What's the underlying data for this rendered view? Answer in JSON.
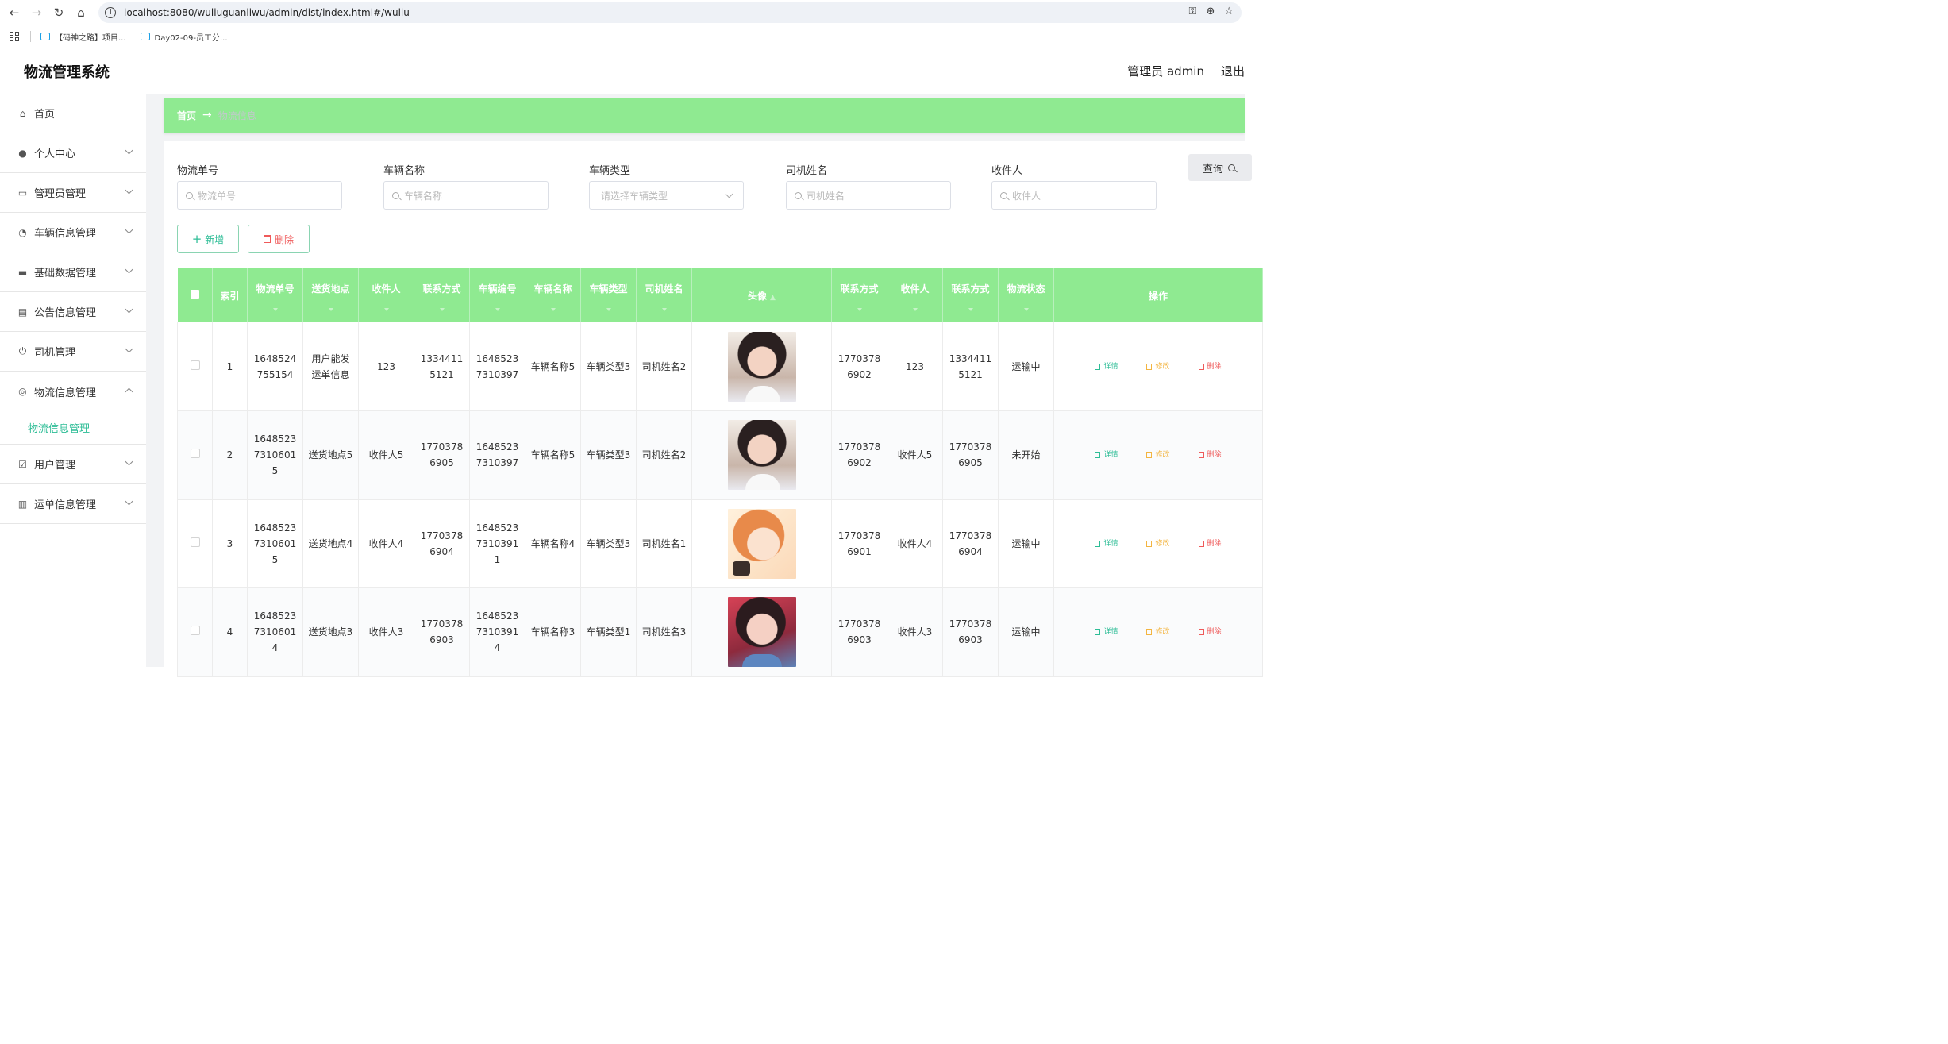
{
  "browser": {
    "url": "localhost:8080/wuliuguanliwu/admin/dist/index.html#/wuliu",
    "bookmarks": [
      "【码神之路】项目...",
      "Day02-09-员工分..."
    ]
  },
  "header": {
    "title": "物流管理系统",
    "user": "管理员 admin",
    "logout": "退出"
  },
  "sidebar": {
    "items": [
      {
        "label": "首页",
        "icon": "home-icon"
      },
      {
        "label": "个人中心",
        "icon": "user-icon"
      },
      {
        "label": "管理员管理",
        "icon": "chat-icon"
      },
      {
        "label": "车辆信息管理",
        "icon": "gauge-icon"
      },
      {
        "label": "基础数据管理",
        "icon": "message-icon"
      },
      {
        "label": "公告信息管理",
        "icon": "clipboard-icon"
      },
      {
        "label": "司机管理",
        "icon": "power-icon"
      },
      {
        "label": "物流信息管理",
        "icon": "compass-icon"
      },
      {
        "label": "用户管理",
        "icon": "checklist-icon"
      },
      {
        "label": "运单信息管理",
        "icon": "bar-chart-icon"
      }
    ],
    "sub_item": "物流信息管理"
  },
  "breadcrumb": {
    "home": "首页",
    "arrow": "→",
    "current": "物流信息"
  },
  "filters": {
    "order_label": "物流单号",
    "order_placeholder": "物流单号",
    "vehicle_name_label": "车辆名称",
    "vehicle_name_placeholder": "车辆名称",
    "vehicle_type_label": "车辆类型",
    "vehicle_type_placeholder": "请选择车辆类型",
    "driver_label": "司机姓名",
    "driver_placeholder": "司机姓名",
    "receiver_label": "收件人",
    "receiver_placeholder": "收件人",
    "query": "查询"
  },
  "actions": {
    "add": "新增",
    "delete": "删除"
  },
  "table": {
    "headers": [
      "索引",
      "物流单号",
      "送货地点",
      "收件人",
      "联系方式",
      "车辆编号",
      "车辆名称",
      "车辆类型",
      "司机姓名",
      "头像",
      "联系方式",
      "收件人",
      "联系方式",
      "物流状态",
      "操作"
    ],
    "rows": [
      {
        "index": "1",
        "order": "1648524755154",
        "address": "用户能发运单信息",
        "receiver": "123",
        "phone": "13344115121",
        "vehicle_no": "16485237310397",
        "vehicle_name": "车辆名称5",
        "vehicle_type": "车辆类型3",
        "driver": "司机姓名2",
        "driver_phone": "17703786902",
        "receiver2": "123",
        "phone2": "13344115121",
        "status": "运输中"
      },
      {
        "index": "2",
        "order": "164852373106015",
        "address": "送货地点5",
        "receiver": "收件人5",
        "phone": "17703786905",
        "vehicle_no": "16485237310397",
        "vehicle_name": "车辆名称5",
        "vehicle_type": "车辆类型3",
        "driver": "司机姓名2",
        "driver_phone": "17703786902",
        "receiver2": "收件人5",
        "phone2": "17703786905",
        "status": "未开始"
      },
      {
        "index": "3",
        "order": "164852373106015",
        "address": "送货地点4",
        "receiver": "收件人4",
        "phone": "17703786904",
        "vehicle_no": "164852373103911",
        "vehicle_name": "车辆名称4",
        "vehicle_type": "车辆类型3",
        "driver": "司机姓名1",
        "driver_phone": "17703786901",
        "receiver2": "收件人4",
        "phone2": "17703786904",
        "status": "运输中"
      },
      {
        "index": "4",
        "order": "164852373106014",
        "address": "送货地点3",
        "receiver": "收件人3",
        "phone": "17703786903",
        "vehicle_no": "164852373103914",
        "vehicle_name": "车辆名称3",
        "vehicle_type": "车辆类型1",
        "driver": "司机姓名3",
        "driver_phone": "17703786903",
        "receiver2": "收件人3",
        "phone2": "17703786903",
        "status": "运输中"
      }
    ],
    "ops": {
      "detail": "详情",
      "edit": "修改",
      "remove": "删除"
    }
  },
  "colors": {
    "accent_green": "#8fea91",
    "primary": "#2dbd96",
    "danger": "#ef5a5a",
    "warning": "#f3b541"
  }
}
